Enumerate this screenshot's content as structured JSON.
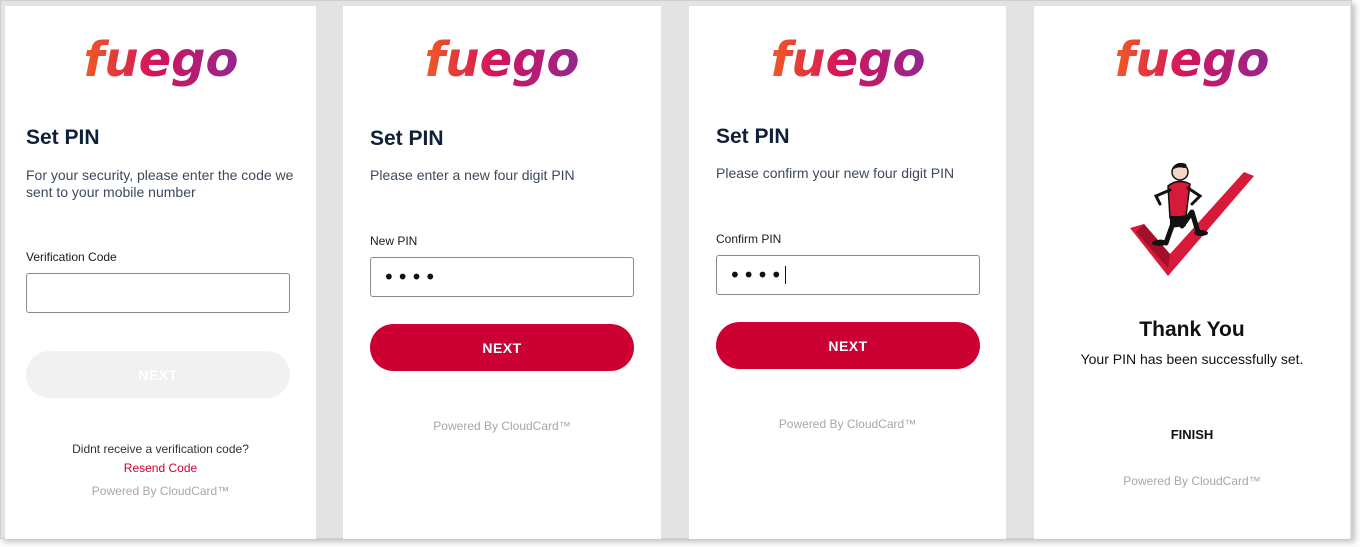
{
  "brand": {
    "name": "fuego",
    "colors": {
      "start": "#f15a24",
      "mid": "#d4145a",
      "end": "#93278f"
    }
  },
  "accent": "#cc0033",
  "panels": [
    {
      "heading": "Set PIN",
      "description": "For your security, please enter the code we sent to your mobile number",
      "field_label": "Verification Code",
      "field_value": "",
      "button_label": "NEXT",
      "resend_prompt": "Didnt receive a verification code?",
      "resend_link": "Resend Code",
      "powered_by": "Powered By CloudCard™"
    },
    {
      "heading": "Set PIN",
      "description": "Please enter a new four digit PIN",
      "field_label": "New PIN",
      "field_value": "••••",
      "button_label": "NEXT",
      "powered_by": "Powered By CloudCard™"
    },
    {
      "heading": "Set PIN",
      "description": "Please confirm your new four digit PIN",
      "field_label": "Confirm PIN",
      "field_value": "••••",
      "button_label": "NEXT",
      "powered_by": "Powered By CloudCard™"
    },
    {
      "illustration": "person-on-checkmark-illustration",
      "heading": "Thank You",
      "description": "Your PIN has been successfully set.",
      "button_label": "FINISH",
      "powered_by": "Powered By CloudCard™"
    }
  ]
}
